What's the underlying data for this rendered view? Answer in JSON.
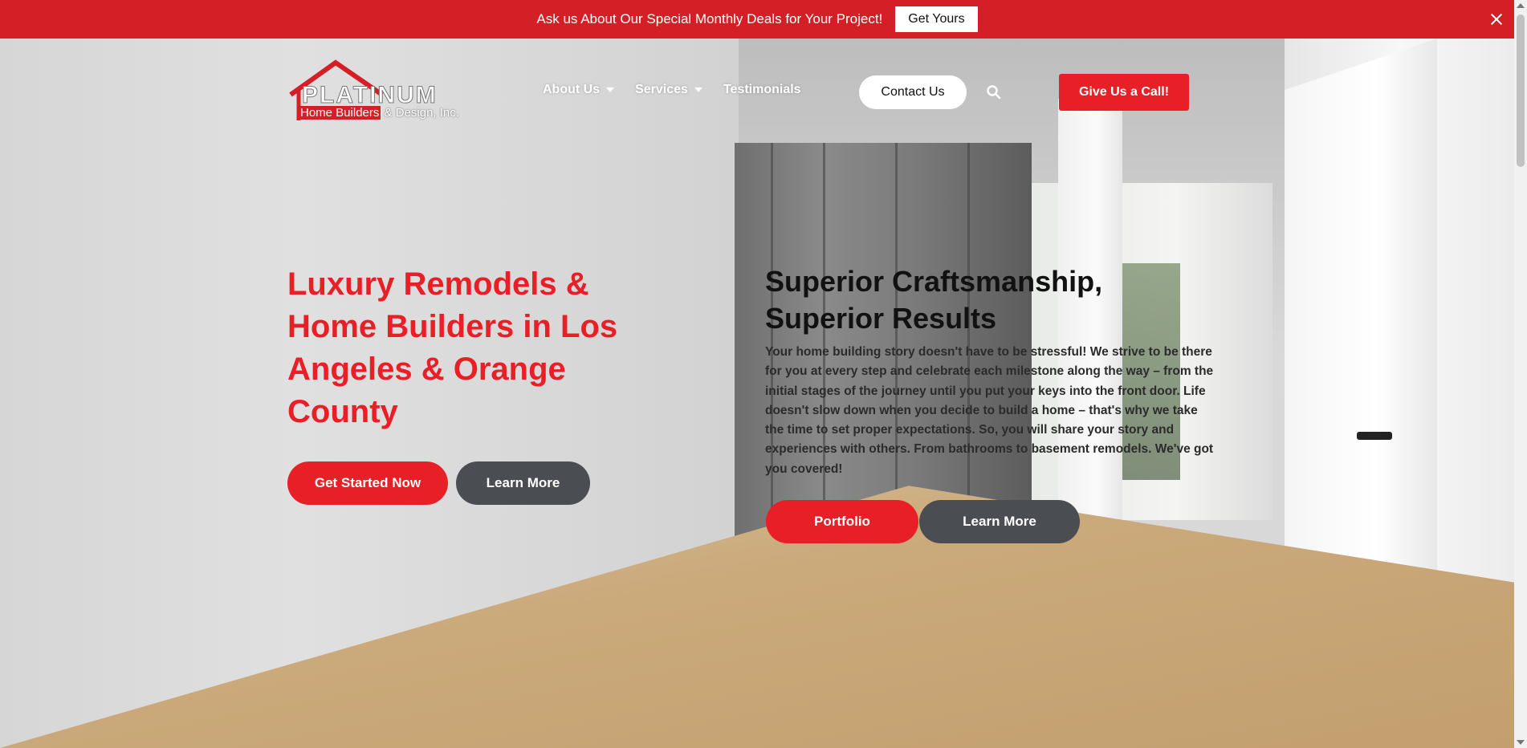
{
  "announcement": {
    "text": "Ask us About Our Special Monthly Deals for Your Project!",
    "button_label": "Get Yours"
  },
  "logo": {
    "main": "PLATINUM",
    "sub_red": "Home Builders",
    "sub_rest": " & Design, Inc."
  },
  "nav": {
    "items": [
      {
        "label": "About Us",
        "dropdown": true
      },
      {
        "label": "Services",
        "dropdown": true
      },
      {
        "label": "Testimonials",
        "dropdown": false
      }
    ],
    "contact_label": "Contact Us",
    "call_label": "Give Us a Call!"
  },
  "hero": {
    "title": "Luxury Remodels & Home Builders in Los Angeles & Orange County",
    "primary_button": "Get Started Now",
    "secondary_button": "Learn More"
  },
  "feature": {
    "title": "Superior Craftsmanship, Superior Results",
    "body": "Your home building story doesn't have to be stressful! We strive to be there for you at every step and celebrate each milestone along the way – from the initial stages of the journey until you put your keys into the front door. Life doesn't slow down when you decide to build a home – that's why we take the time to set proper expectations. So, you will share your story and experiences with others. From bathrooms to basement remodels. We've got you covered!",
    "primary_button": "Portfolio",
    "secondary_button": "Learn More"
  },
  "colors": {
    "brand_red": "#e81f27",
    "topbar_red": "#d41f26",
    "dark_button": "#4a4d52"
  }
}
